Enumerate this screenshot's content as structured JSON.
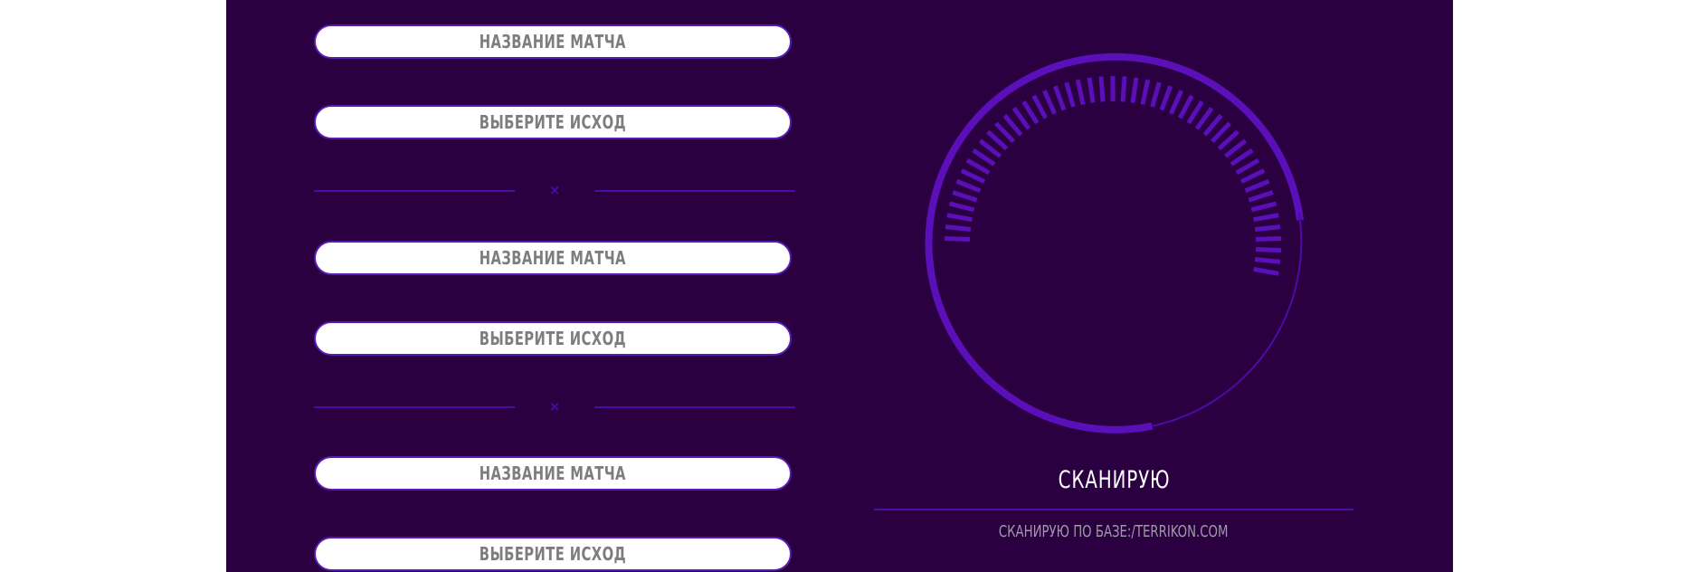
{
  "matches": [
    {
      "name_label": "НАЗВАНИЕ МАТЧА",
      "outcome_label": "ВЫБЕРИТЕ ИСХОД"
    },
    {
      "name_label": "НАЗВАНИЕ МАТЧА",
      "outcome_label": "ВЫБЕРИТЕ ИСХОД"
    },
    {
      "name_label": "НАЗВАНИЕ МАТЧА",
      "outcome_label": "ВЫБЕРИТЕ ИСХОД"
    }
  ],
  "separator_symbol": "×",
  "scanner": {
    "status": "СКАНИРУЮ",
    "source": "СКАНИРУЮ ПО БАЗЕ:/TERRIKON.COM"
  },
  "colors": {
    "panel_background": "#2a0041",
    "accent": "#5a0fb8",
    "pill_background": "#ffffff",
    "pill_text": "#7d7d7d",
    "status_text": "#ffffff",
    "source_text": "#9e9aa6"
  },
  "icons": {
    "separator": "close-icon",
    "radar": "radar-spinner-icon"
  }
}
